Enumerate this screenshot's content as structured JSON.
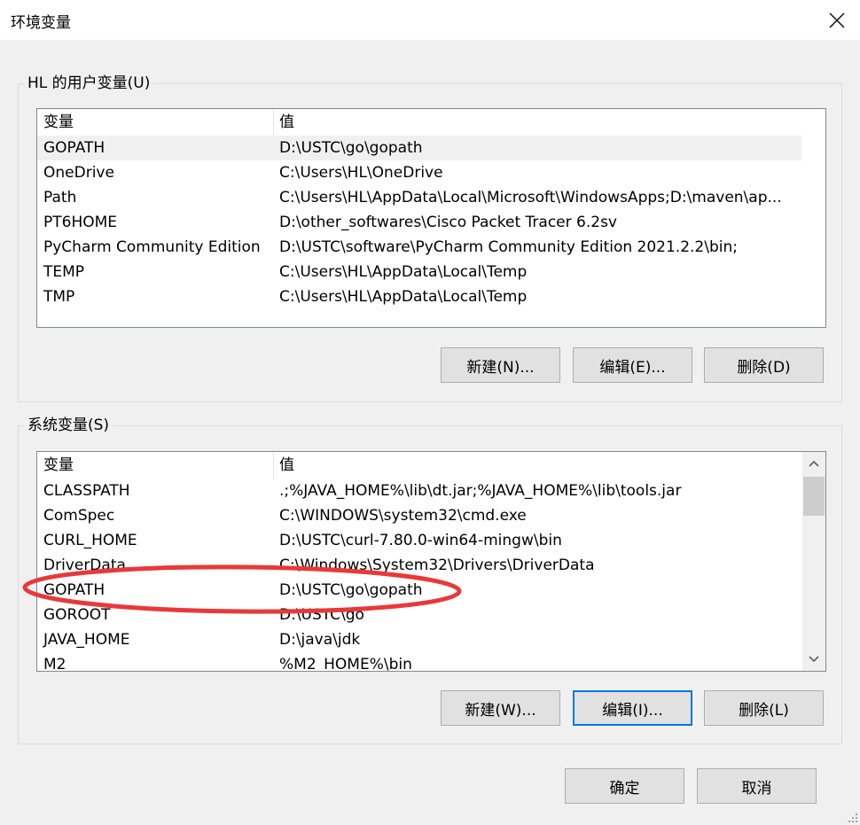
{
  "window": {
    "title": "环境变量"
  },
  "user_vars": {
    "group_label": "HL 的用户变量(U)",
    "columns": {
      "name": "变量",
      "value": "值"
    },
    "rows": [
      {
        "name": "GOPATH",
        "value": "D:\\USTC\\go\\gopath"
      },
      {
        "name": "OneDrive",
        "value": "C:\\Users\\HL\\OneDrive"
      },
      {
        "name": "Path",
        "value": "C:\\Users\\HL\\AppData\\Local\\Microsoft\\WindowsApps;D:\\maven\\ap..."
      },
      {
        "name": "PT6HOME",
        "value": "D:\\other_softwares\\Cisco Packet Tracer 6.2sv"
      },
      {
        "name": "PyCharm Community Edition",
        "value": "D:\\USTC\\software\\PyCharm Community Edition 2021.2.2\\bin;"
      },
      {
        "name": "TEMP",
        "value": "C:\\Users\\HL\\AppData\\Local\\Temp"
      },
      {
        "name": "TMP",
        "value": "C:\\Users\\HL\\AppData\\Local\\Temp"
      }
    ],
    "buttons": {
      "new": "新建(N)...",
      "edit": "编辑(E)...",
      "delete": "删除(D)"
    }
  },
  "system_vars": {
    "group_label": "系统变量(S)",
    "columns": {
      "name": "变量",
      "value": "值"
    },
    "rows": [
      {
        "name": "CLASSPATH",
        "value": ".;%JAVA_HOME%\\lib\\dt.jar;%JAVA_HOME%\\lib\\tools.jar"
      },
      {
        "name": "ComSpec",
        "value": "C:\\WINDOWS\\system32\\cmd.exe"
      },
      {
        "name": "CURL_HOME",
        "value": "D:\\USTC\\curl-7.80.0-win64-mingw\\bin"
      },
      {
        "name": "DriverData",
        "value": "C:\\Windows\\System32\\Drivers\\DriverData"
      },
      {
        "name": "GOPATH",
        "value": "D:\\USTC\\go\\gopath"
      },
      {
        "name": "GOROOT",
        "value": "D:\\USTC\\go"
      },
      {
        "name": "JAVA_HOME",
        "value": "D:\\java\\jdk"
      },
      {
        "name": "M2",
        "value": "%M2_HOME%\\bin"
      }
    ],
    "buttons": {
      "new": "新建(W)...",
      "edit": "编辑(I)...",
      "delete": "删除(L)"
    }
  },
  "dialog_buttons": {
    "ok": "确定",
    "cancel": "取消"
  },
  "annotation": {
    "color": "#e8393a"
  },
  "icons": {
    "close": "close-icon",
    "scroll_up": "chevron-up-icon",
    "scroll_down": "chevron-down-icon",
    "grip": "resize-grip-icon"
  }
}
